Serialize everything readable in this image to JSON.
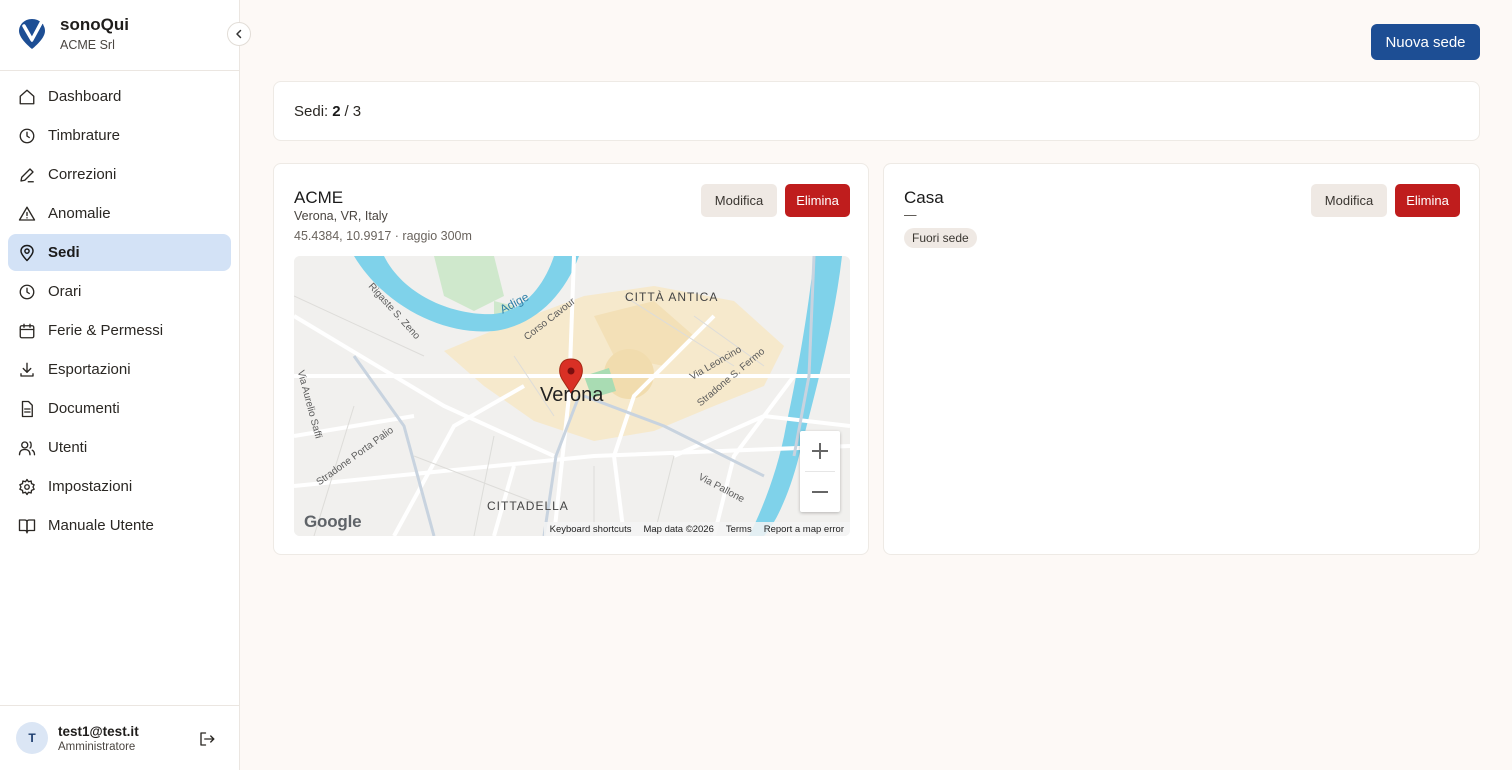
{
  "brand": {
    "name": "sonoQui",
    "org": "ACME Srl"
  },
  "nav": [
    {
      "label": "Dashboard",
      "icon": "home-icon",
      "active": false
    },
    {
      "label": "Timbrature",
      "icon": "clock-icon",
      "active": false
    },
    {
      "label": "Correzioni",
      "icon": "pencil-icon",
      "active": false
    },
    {
      "label": "Anomalie",
      "icon": "warning-icon",
      "active": false
    },
    {
      "label": "Sedi",
      "icon": "map-pin-icon",
      "active": true
    },
    {
      "label": "Orari",
      "icon": "clock-icon",
      "active": false
    },
    {
      "label": "Ferie & Permessi",
      "icon": "calendar-icon",
      "active": false
    },
    {
      "label": "Esportazioni",
      "icon": "download-icon",
      "active": false
    },
    {
      "label": "Documenti",
      "icon": "document-icon",
      "active": false
    },
    {
      "label": "Utenti",
      "icon": "users-icon",
      "active": false
    },
    {
      "label": "Impostazioni",
      "icon": "gear-icon",
      "active": false
    },
    {
      "label": "Manuale Utente",
      "icon": "book-icon",
      "active": false
    }
  ],
  "user": {
    "initial": "T",
    "email": "test1@test.it",
    "role": "Amministratore"
  },
  "header": {
    "new_button": "Nuova sede"
  },
  "counter": {
    "label": "Sedi:",
    "current": "2",
    "separator": "/",
    "max": "3"
  },
  "sites": [
    {
      "name": "ACME",
      "address": "Verona, VR, Italy",
      "coords": "45.4384, 10.9917 · raggio 300m",
      "edit_label": "Modifica",
      "delete_label": "Elimina",
      "map": {
        "city_label": "Verona",
        "district_labels": [
          "CITTÀ ANTICA",
          "CITTADELLA"
        ],
        "river_label": "Adige",
        "street_labels": [
          "Rigaste S. Zeno",
          "Corso Cavour",
          "Via Leoncino",
          "Stradone S. Fermo",
          "Via Aurelio Saffi",
          "Stradone Porta Palio",
          "Via Pallone"
        ],
        "zoom_in": "+",
        "zoom_out": "−",
        "google_logo": "Google",
        "footer": [
          "Keyboard shortcuts",
          "Map data ©2026",
          "Terms",
          "Report a map error"
        ]
      }
    },
    {
      "name": "Casa",
      "address": "—",
      "badge": "Fuori sede",
      "edit_label": "Modifica",
      "delete_label": "Elimina"
    }
  ],
  "colors": {
    "primary": "#1d4e94",
    "danger": "#bf1d1d",
    "active_nav": "#d3e2f6",
    "background": "#fdf9f6"
  }
}
